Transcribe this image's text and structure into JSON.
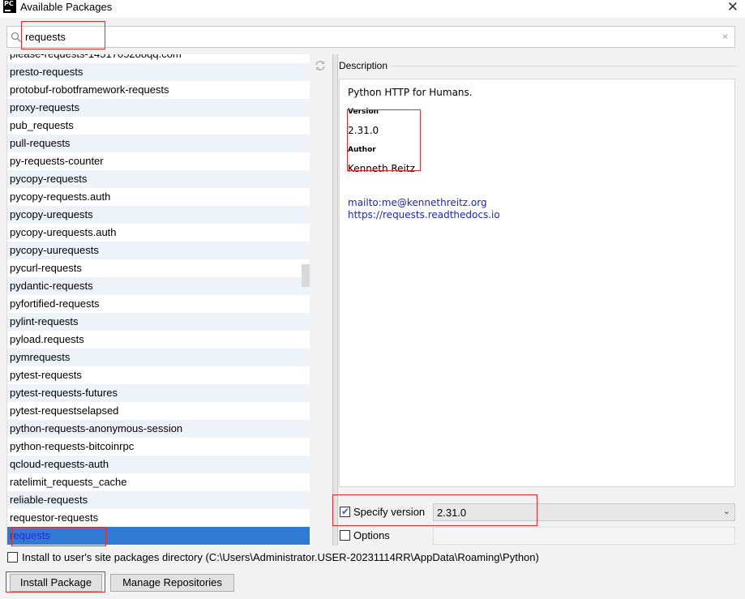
{
  "window": {
    "title": "Available Packages",
    "logo_text": "PC"
  },
  "search": {
    "value": "requests",
    "clear_glyph": "×"
  },
  "packages": [
    "please-requests-1451705288qq.com",
    "presto-requests",
    "protobuf-robotframework-requests",
    "proxy-requests",
    "pub_requests",
    "pull-requests",
    "py-requests-counter",
    "pycopy-requests",
    "pycopy-requests.auth",
    "pycopy-urequests",
    "pycopy-urequests.auth",
    "pycopy-uurequests",
    "pycurl-requests",
    "pydantic-requests",
    "pyfortified-requests",
    "pylint-requests",
    "pyload.requests",
    "pymrequests",
    "pytest-requests",
    "pytest-requests-futures",
    "pytest-requestselapsed",
    "python-requests-anonymous-session",
    "python-requests-bitcoinrpc",
    "qcloud-requests-auth",
    "ratelimit_requests_cache",
    "reliable-requests",
    "requestor-requests",
    "requests"
  ],
  "selected_package": "requests",
  "description": {
    "label": "Description",
    "summary": "Python HTTP for Humans.",
    "version_heading": "Version",
    "version": "2.31.0",
    "author_heading": "Author",
    "author": "Kenneth Reitz",
    "email_link": "mailto:me@kennethreitz.org",
    "homepage_link": "https://requests.readthedocs.io"
  },
  "specify_version": {
    "label": "Specify version",
    "checked": true,
    "value": "2.31.0"
  },
  "options": {
    "label": "Options",
    "checked": false,
    "value": ""
  },
  "install_to_user": {
    "label": "Install to user's site packages directory (C:\\Users\\Administrator.USER-20231114RR\\AppData\\Roaming\\Python)",
    "checked": false
  },
  "buttons": {
    "install": "Install Package",
    "manage": "Manage Repositories"
  },
  "icons": {
    "search": "search-icon",
    "refresh": "refresh-icon",
    "close": "close-icon",
    "chevron": "chevron-down-icon"
  },
  "colors": {
    "selection": "#2f7bd3",
    "link": "#1a25c8",
    "annotation": "#e42a2a",
    "alt_row": "#eef3fa"
  }
}
